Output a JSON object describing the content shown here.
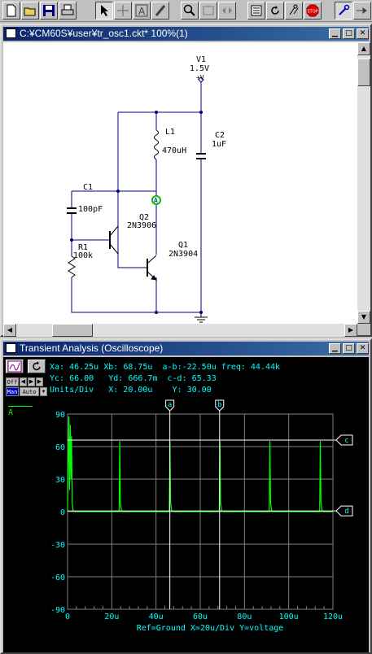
{
  "toolbar": {
    "icons": [
      "new-icon",
      "open-icon",
      "save-icon",
      "print-icon",
      "pointer-icon",
      "crosshair-icon",
      "text-icon",
      "wire-icon",
      "zoom-icon",
      "zoom-fit-icon",
      "flip-icon",
      "netlist-icon",
      "rotate-icon",
      "probe-icon",
      "stop-icon",
      "probe-pen-icon",
      "arrow-terminal-icon"
    ],
    "stop_label": "STOP"
  },
  "schematic_window": {
    "title": "C:¥CM60S¥user¥tr_osc1.ckt* 100%(1)",
    "components": {
      "v1": {
        "name": "V1",
        "value": "1.5V",
        "terminal": "+V"
      },
      "l1": {
        "name": "L1",
        "value": "470uH"
      },
      "c2": {
        "name": "C2",
        "value": "1uF"
      },
      "c1": {
        "name": "C1",
        "value": "100pF"
      },
      "q2": {
        "name": "Q2",
        "value": "2N3906"
      },
      "r1": {
        "name": "R1",
        "value": "100k"
      },
      "q1": {
        "name": "Q1",
        "value": "2N3904"
      },
      "probe": {
        "label": "A"
      }
    }
  },
  "scope_window": {
    "title": "Transient Analysis (Oscilloscope)",
    "readout": {
      "xa": "Xa: 46.25u",
      "xb": "Xb: 68.75u",
      "ab": "a-b:-22.50u",
      "freq": "freq: 44.44k",
      "yc": "Yc: 66.00",
      "yd": "Yd: 666.7m",
      "cd": "c-d: 65.33",
      "units": "Units/Div",
      "xunit": "X: 20.00u",
      "yunit": "Y: 30.00"
    },
    "buttons": {
      "off": "Off",
      "man": "Man",
      "auto": "Auto"
    },
    "trace_label": "A",
    "footer": "Ref=Ground  X=20u/Div Y=voltage",
    "cursor_labels": {
      "a": "a",
      "b": "b",
      "c": "c",
      "d": "d"
    },
    "trace_color": "#00ff00",
    "grid_color": "#808080",
    "text_color": "#00ffff"
  },
  "chart_data": {
    "type": "line",
    "xlabel": "",
    "ylabel": "",
    "xlim": [
      0,
      120
    ],
    "ylim": [
      -90,
      90
    ],
    "x_ticks": [
      "0",
      "20u",
      "40u",
      "60u",
      "80u",
      "100u",
      "120u"
    ],
    "y_ticks": [
      "90",
      "60",
      "30",
      "0",
      "-30",
      "-60",
      "-90"
    ],
    "cursors": {
      "xa": 46.25,
      "xb": 68.75,
      "yc": 66.0,
      "yd": 0.6667
    },
    "series": [
      {
        "x": [
          0,
          0.6,
          0.9,
          1.2,
          1.5,
          1.8,
          2.1,
          2.5,
          3.0,
          23.3,
          23.6,
          23.9,
          24.4,
          24.9,
          46.0,
          46.3,
          46.6,
          47.1,
          47.6,
          68.6,
          68.9,
          69.2,
          69.7,
          70.2,
          91.2,
          91.5,
          91.8,
          92.3,
          92.8,
          114.0,
          114.3,
          114.6,
          115.1,
          115.6,
          120
        ],
        "y": [
          0,
          88,
          20,
          80,
          30,
          70,
          8,
          1,
          0,
          0,
          65,
          8,
          1,
          0,
          0,
          65,
          8,
          1,
          0,
          0,
          65,
          8,
          1,
          0,
          0,
          65,
          8,
          1,
          0,
          0,
          65,
          8,
          1,
          0,
          0
        ]
      }
    ]
  }
}
